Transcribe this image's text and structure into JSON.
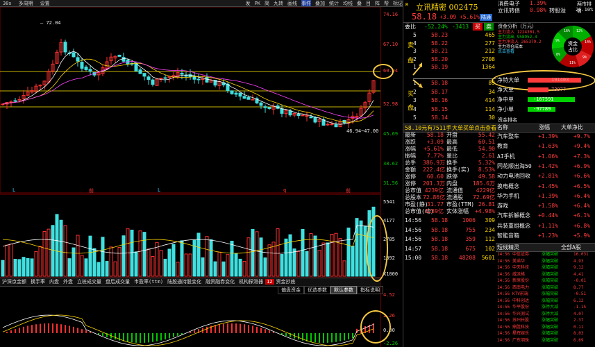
{
  "toolbar": {
    "period": "30s",
    "items": [
      "多周期",
      "设置"
    ],
    "right_items": [
      "发",
      "PK",
      "简",
      "九转",
      "画线",
      "事件",
      "叠加",
      "统计",
      "均线",
      "叠",
      "目",
      "阵",
      "帮",
      "标记"
    ]
  },
  "chart": {
    "price_axis": [
      "74.16",
      "67.10",
      "60.04",
      "52.98",
      "45.69",
      "38.62",
      "31.56"
    ],
    "volume_axis": [
      "5541",
      "4177",
      "2785",
      "1392",
      "X1000"
    ],
    "macd_axis": [
      "4.52",
      "2.26",
      "0.00",
      "-2.26"
    ],
    "high_mark": "72.04",
    "low_mark": "46.94~47.00",
    "markers": [
      "L",
      "前",
      "L",
      "q",
      "前"
    ],
    "indicator_tabs": [
      "沪深京金额",
      "换手率",
      "内盘",
      "外盘",
      "立桩成交量",
      "盘后成交量",
      "市盈率(ttm)",
      "陆股通持股变化",
      "融资融券变化",
      "机构探测器",
      "资金抄底"
    ],
    "indicator_tab_marker": "12",
    "bottom_tabs": [
      "偏盘资金",
      "优选参数",
      "默认参数",
      "指标说明"
    ]
  },
  "quote": {
    "title_code": "R",
    "name": "立讯精密",
    "code": "002475",
    "price": "58.18",
    "change": "+3.09",
    "change_pct": "+5.61%",
    "tag": "陆通",
    "related": [
      {
        "name": "消费电子",
        "pct": "1.39%",
        "label": "两市排名"
      },
      {
        "name": "立讯转债",
        "pct": "0.98%",
        "label": "转股溢",
        "extra": "26.10%"
      }
    ],
    "ratio_label": "委比",
    "ratio": "-52.24%",
    "diff": "-3413",
    "buy_btn": "买",
    "sell_btn": "卖",
    "fund_title": "资金分析（万元）",
    "fund_lines": [
      "主力流入 1224301.5",
      "主力流出 958952.3",
      "主力净流入 265379.2",
      "主力持仓成本",
      "点击查看"
    ],
    "pie": {
      "center1": "资金",
      "center2": "占比",
      "pcts": [
        "12%",
        "11%",
        "14%",
        "9%",
        "11%",
        "8%",
        "9%",
        "16%"
      ]
    }
  },
  "sell_levels": [
    {
      "lvl": "5",
      "price": "58.23",
      "vol": "465"
    },
    {
      "lvl": "4",
      "price": "58.22",
      "vol": "277"
    },
    {
      "lvl": "3",
      "price": "58.21",
      "vol": "212"
    },
    {
      "lvl": "2",
      "price": "58.20",
      "vol": "2708"
    },
    {
      "lvl": "1",
      "price": "58.19",
      "vol": "1364"
    }
  ],
  "buy_levels": [
    {
      "lvl": "1",
      "price": "58.18",
      "vol": "89"
    },
    {
      "lvl": "2",
      "price": "58.17",
      "vol": "34"
    },
    {
      "lvl": "3",
      "price": "58.16",
      "vol": "414"
    },
    {
      "lvl": "4",
      "price": "58.15",
      "vol": "114"
    },
    {
      "lvl": "5",
      "price": "58.14",
      "vol": "30"
    }
  ],
  "side_labels": {
    "sell1": "卖",
    "sell2": "盘",
    "buy1": "买",
    "buy2": "盘"
  },
  "netflow": [
    {
      "label": "净特大单",
      "value": "191403",
      "color": "#ff3b3b",
      "ratio": 0.85
    },
    {
      "label": "净大单",
      "value": "73977",
      "color": "#ff3b3b",
      "ratio": 0.33
    },
    {
      "label": "净中单",
      "value": "-167591",
      "color": "#00d000",
      "ratio": 0.75
    },
    {
      "label": "净小单",
      "value": "-97789",
      "color": "#00d000",
      "ratio": 0.44
    }
  ],
  "flow_rank_title": "资金排名",
  "stats_header": {
    "amount": "58.10元有",
    "amount2": "7511手",
    "link": "大单买单点击查看"
  },
  "stats": [
    [
      "最新",
      "58.18",
      "开盘",
      "55.42"
    ],
    [
      "涨跌",
      "+3.09",
      "最高",
      "60.51"
    ],
    [
      "涨幅",
      "+5.61%",
      "最低",
      "54.90"
    ],
    [
      "振幅",
      "7.77%",
      "量比",
      "2.61"
    ],
    [
      "总手",
      "386.9万",
      "换手",
      "5.32%"
    ],
    [
      "金额",
      "222.4亿",
      "换手(实)",
      "8.53%"
    ],
    [
      "涨停",
      "60.60",
      "跌停",
      "49.58"
    ],
    [
      "涨停",
      "201.3万",
      "内盘",
      "185.6万"
    ],
    [
      "总市值",
      "4239亿",
      "流通值",
      "4229亿"
    ],
    [
      "总股本",
      "72.86亿",
      "流通股",
      "72.69亿"
    ],
    [
      "市盈(静)",
      "31.77",
      "市盈(TTM)",
      "26.81"
    ],
    [
      "总市值(动)",
      "4239亿",
      "实体涨幅",
      "+4.98%"
    ]
  ],
  "sector_header": [
    "名称",
    "涨幅",
    "大单净比"
  ],
  "sectors": [
    [
      "汽车整车",
      "+1.39%",
      "+9.7%"
    ],
    [
      "教育",
      "+1.63%",
      "+9.4%"
    ],
    [
      "AI手机",
      "+1.06%",
      "+7.3%"
    ],
    [
      "同花顺出海50",
      "+1.42%",
      "+6.9%"
    ],
    [
      "动力电池回收",
      "+2.81%",
      "+6.6%"
    ],
    [
      "换电概念",
      "+1.45%",
      "+6.5%"
    ],
    [
      "华为手机",
      "+1.39%",
      "+6.4%"
    ],
    [
      "游戏",
      "+1.58%",
      "+6.4%"
    ],
    [
      "汽车拆解概念",
      "+0.44%",
      "+6.1%"
    ],
    [
      "兵装重组概念",
      "+1.11%",
      "+6.8%"
    ],
    [
      "智能音箱",
      "+1.23%",
      "+5.9%"
    ]
  ],
  "ticks": [
    [
      "14:56",
      "58.18",
      "1006",
      "309"
    ],
    [
      "14:56",
      "58.18",
      "755",
      "234"
    ],
    [
      "14:56",
      "58.18",
      "359",
      "112"
    ],
    [
      "14:57",
      "58.18",
      "675",
      "102"
    ],
    [
      "15:00",
      "58.18",
      "48208",
      "5601"
    ]
  ],
  "news_header": [
    "短线精灵",
    "全部A股"
  ],
  "news": [
    [
      "14:56",
      "中信证券",
      "涨幅突破"
    ],
    [
      "14:56",
      "美诺华",
      "涨幅突破"
    ],
    [
      "14:56",
      "中天科技",
      "涨幅突破"
    ],
    [
      "14:56",
      "威派格",
      "涨幅突破"
    ],
    [
      "14:56",
      "新原股份",
      "涨幅突破"
    ],
    [
      "14:56",
      "西南电力",
      "涨幅突破"
    ],
    [
      "14:56",
      "KTV前端",
      "涨幅突破"
    ],
    [
      "14:56",
      "中科创达",
      "涨幅突破"
    ],
    [
      "14:56",
      "华平股份",
      "涨停大减"
    ],
    [
      "14:56",
      "华兴测试",
      "涨停大减"
    ],
    [
      "14:56",
      "苏州长股",
      "涨幅突破"
    ],
    [
      "14:56",
      "鼎胜科技",
      "涨幅突破"
    ],
    [
      "14:56",
      "星辉娱乐",
      "涨幅突破"
    ],
    [
      "14:56",
      "广东明珠",
      "涨幅突破"
    ]
  ],
  "news_vals": [
    "16.031",
    "4.93",
    "9.12",
    "4.41",
    "-0.01",
    "8.77",
    "-0.51",
    "6.12",
    "-1.15",
    "4.07",
    "2.37",
    "0.11",
    "8.03",
    "6.69"
  ]
}
